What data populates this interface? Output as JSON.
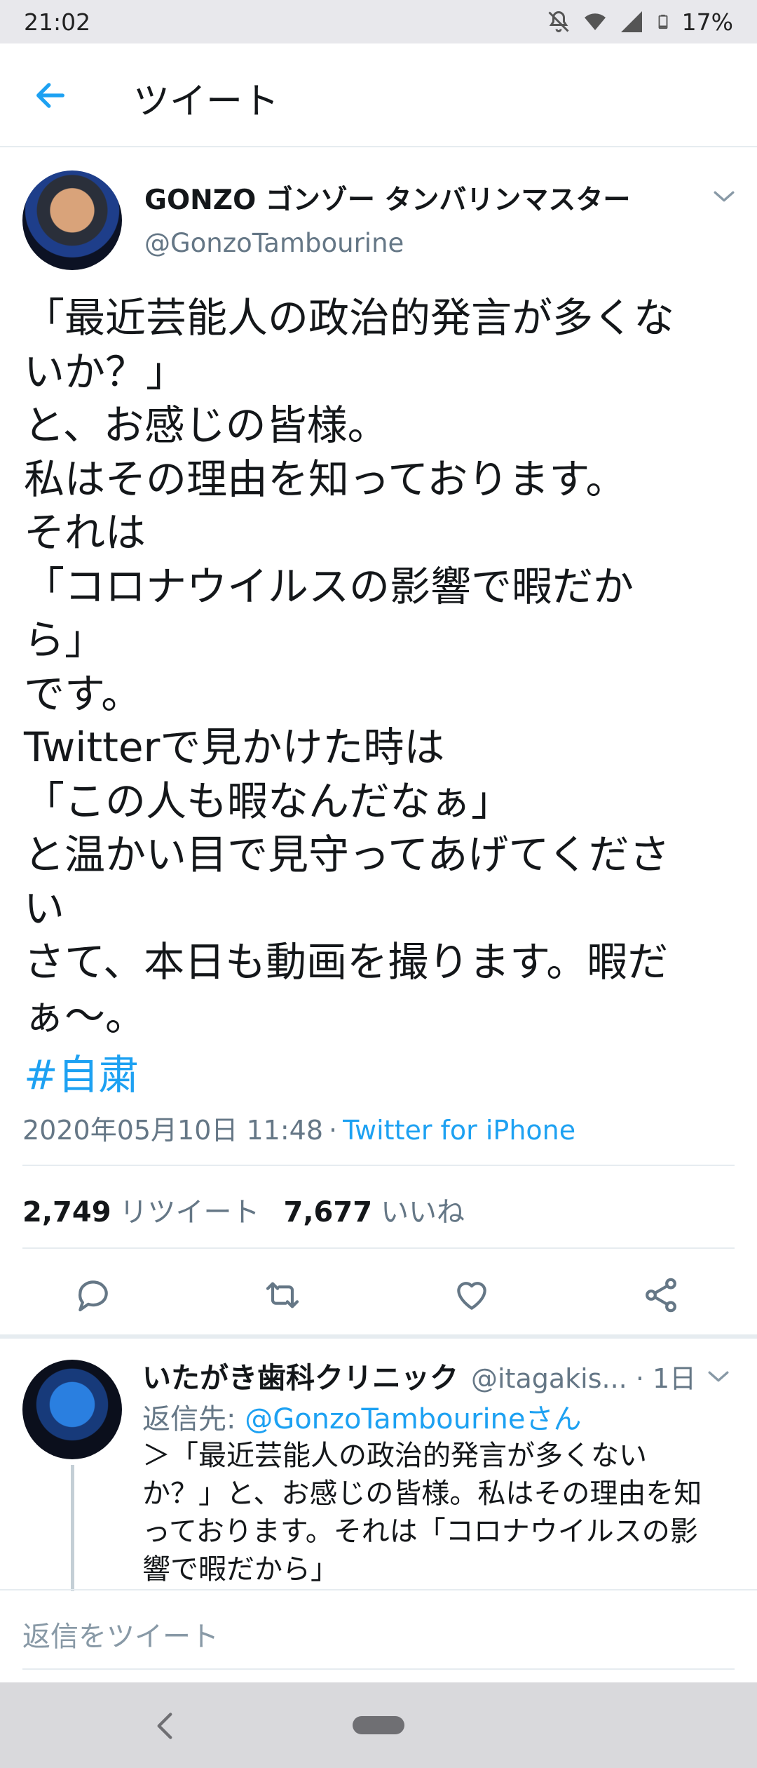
{
  "status_bar": {
    "time": "21:02",
    "battery": "17%",
    "icons": [
      "mute-icon",
      "wifi-icon",
      "signal-icon",
      "battery-icon"
    ]
  },
  "header": {
    "title": "ツイート",
    "back_icon": "arrow-left-icon"
  },
  "tweet": {
    "author_name": "GONZO ゴンゾー タンバリンマスター",
    "author_handle": "@GonzoTambourine",
    "body_lines": [
      "「最近芸能人の政治的発言が多くな",
      "いか？」",
      "と、お感じの皆様。",
      "私はその理由を知っております。",
      "それは",
      "「コロナウイルスの影響で暇だか",
      "ら」",
      "です。",
      "Twitterで見かけた時は",
      "「この人も暇なんだなぁ」",
      "と温かい目で見守ってあげてくださ",
      "い",
      "さて、本日も動画を撮ります。暇だ",
      "ぁ〜。"
    ],
    "hashtag": "#自粛",
    "timestamp": "2020年05月10日 11:48",
    "separator": "·",
    "source": "Twitter for iPhone",
    "retweets_count": "2,749",
    "retweets_label": "リツイート",
    "likes_count": "7,677",
    "likes_label": "いいね"
  },
  "reply": {
    "name": "いたがき歯科クリニック",
    "handle_time": "@itagakis... · 1日",
    "reply_to_prefix": "返信先: ",
    "reply_to_mention": "@GonzoTambourineさん",
    "text_lines": [
      "＞「最近芸能人の政治的発言が多くない",
      "か？」と、お感じの皆様。私はその理由を知",
      "っております。それは「コロナウイルスの影",
      "響で暇だから」"
    ]
  },
  "compose": {
    "placeholder": "返信をツイート"
  },
  "colors": {
    "accent": "#1da1f2",
    "secondary_text": "#657786",
    "divider": "#e6ecf0"
  }
}
